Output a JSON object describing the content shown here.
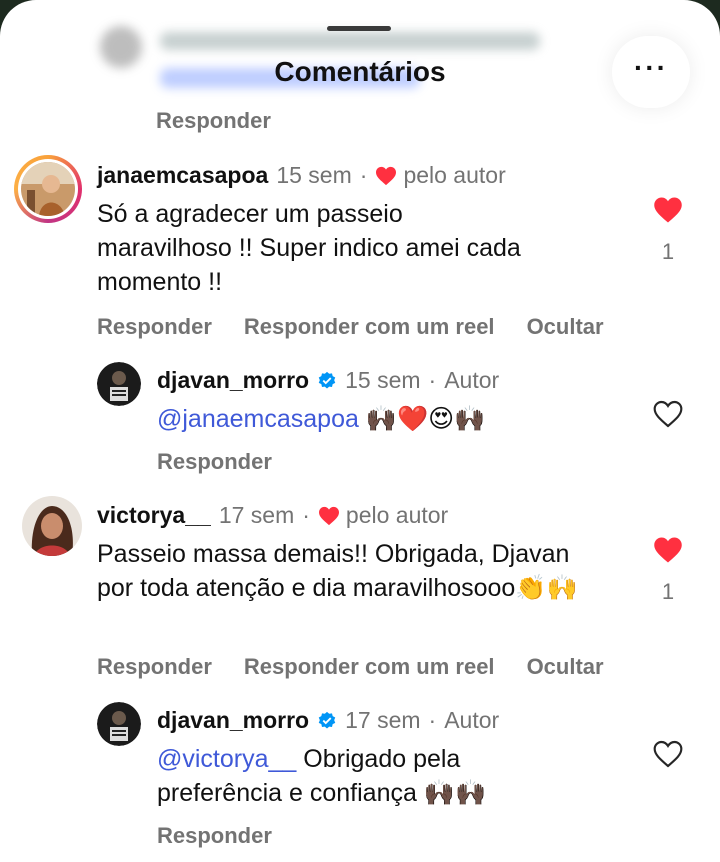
{
  "header": {
    "title": "Comentários",
    "more_label": "···",
    "prev_reply": "Responder"
  },
  "comments": [
    {
      "username": "janaemcasapoa",
      "time": "15 sem",
      "liked_by_author": "pelo autor",
      "text": "Só a agradecer um passeio maravilhoso !! Super indico amei cada momento !!",
      "like_count": "1",
      "actions": [
        "Responder",
        "Responder com um reel",
        "Ocultar"
      ],
      "reply": {
        "username": "djavan_morro",
        "time": "15 sem",
        "role": "Autor",
        "mention": "@janaemcasapoa",
        "text": "",
        "emojis": "🙌🏿❤️😍🙌🏿",
        "action": "Responder"
      }
    },
    {
      "username": "victorya__",
      "time": "17 sem",
      "liked_by_author": "pelo autor",
      "text": "Passeio massa demais!! Obrigada, Djavan por toda atenção e dia maravilhosooo",
      "emojis": "👏🙌",
      "like_count": "1",
      "actions": [
        "Responder",
        "Responder com um reel",
        "Ocultar"
      ],
      "reply": {
        "username": "djavan_morro",
        "time": "17 sem",
        "role": "Autor",
        "mention": "@victorya__",
        "text_line1": "Obrigado pela",
        "text_line2": "preferência e confiança",
        "emojis": "🙌🏿🙌🏿",
        "action": "Responder"
      }
    }
  ],
  "colors": {
    "heart_red": "#ff3040",
    "mention_blue": "#3f59d8",
    "muted_gray": "#737373",
    "verified_blue": "#0095f6"
  }
}
